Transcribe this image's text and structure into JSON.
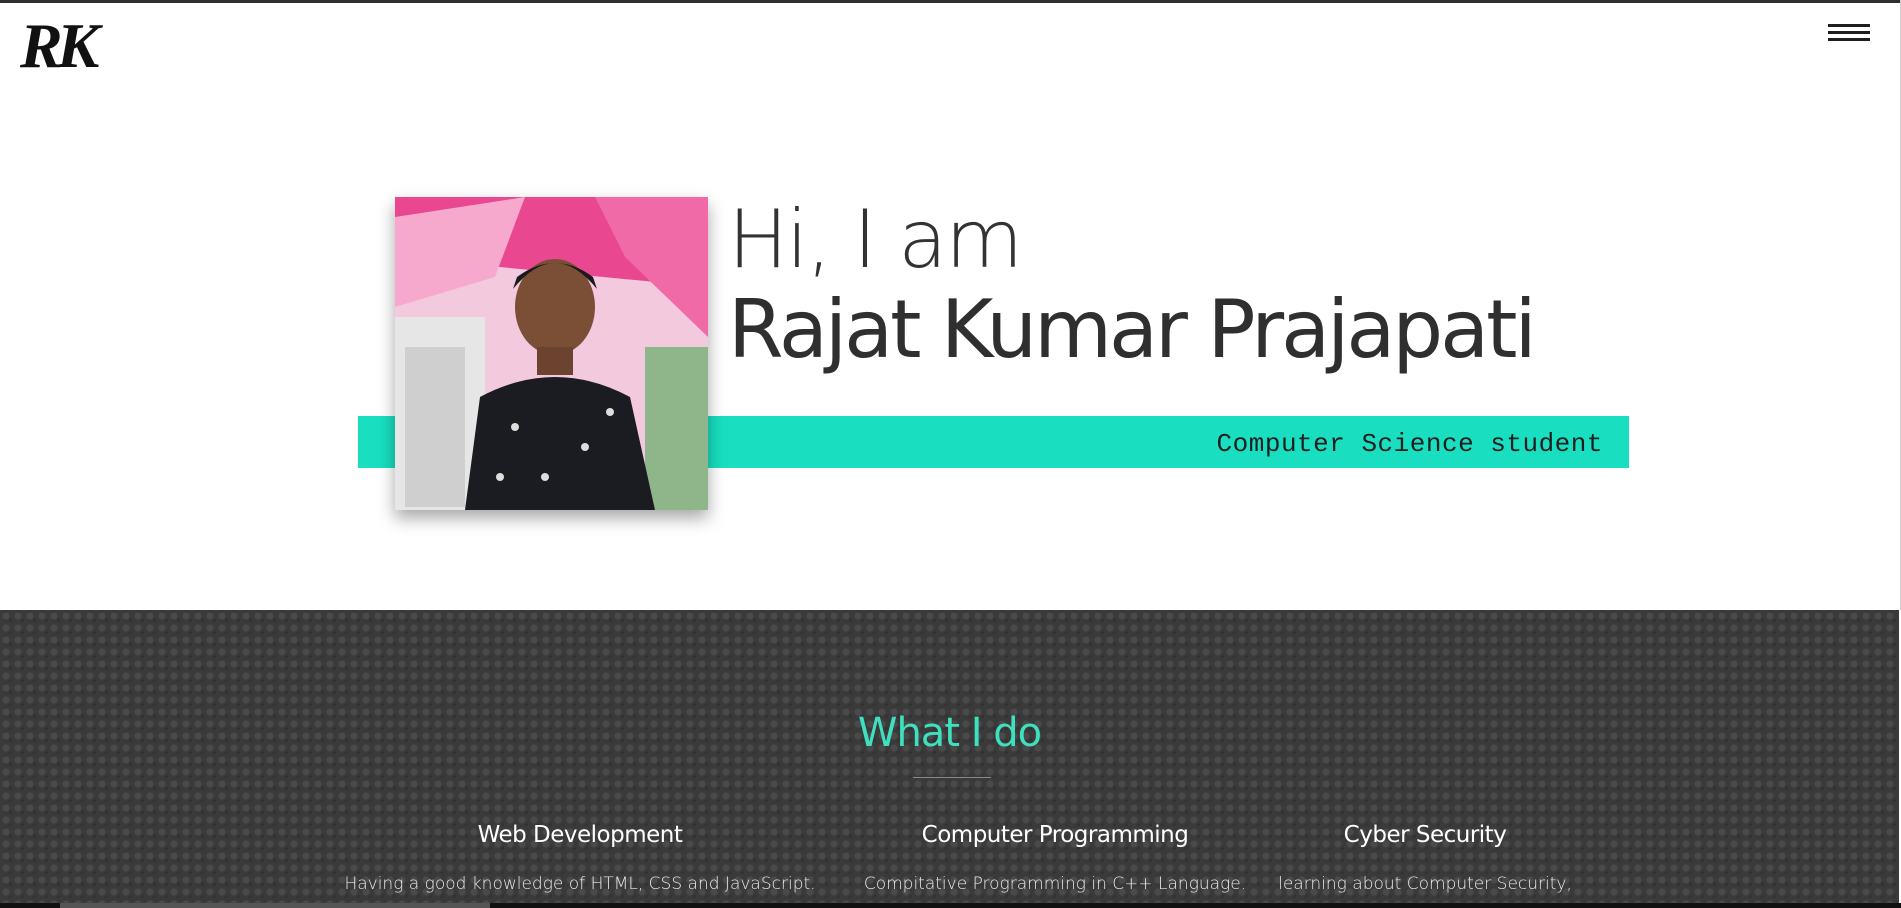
{
  "header": {
    "logo_text": "RK",
    "menu_icon": "hamburger-icon"
  },
  "hero": {
    "greeting": "Hi, I am",
    "name": "Rajat Kumar Prajapati",
    "tagline": "Computer Science student",
    "photo_alt": "profile photo"
  },
  "services": {
    "title": "What I do",
    "items": [
      {
        "title": "Web Development",
        "description": "Having a good knowledge of HTML, CSS and JavaScript."
      },
      {
        "title": "Computer Programming",
        "description": "Compitative Programming in C++ Language."
      },
      {
        "title": "Cyber Security",
        "description": "learning about Computer Security,"
      }
    ]
  },
  "colors": {
    "accent": "#19dfc0",
    "section_title": "#3ee0bd",
    "dark_bg": "#3a3a3a"
  }
}
